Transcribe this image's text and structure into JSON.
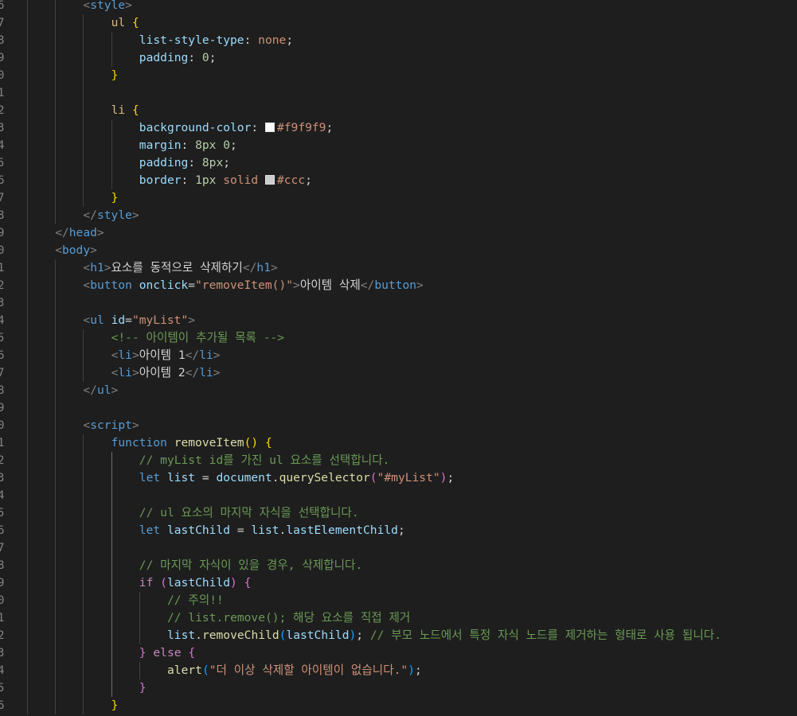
{
  "editor": {
    "language": "html",
    "theme": "dark",
    "lines": [
      {
        "n": "6",
        "indent": 2,
        "parts": [
          [
            "br",
            "<"
          ],
          [
            "tag",
            "style"
          ],
          [
            "br",
            ">"
          ]
        ]
      },
      {
        "n": "7",
        "indent": 3,
        "parts": [
          [
            "sel",
            "ul"
          ],
          [
            "txt",
            " "
          ],
          [
            "y",
            "{"
          ]
        ]
      },
      {
        "n": "8",
        "indent": 4,
        "parts": [
          [
            "prop",
            "list-style-type"
          ],
          [
            "txt",
            ": "
          ],
          [
            "val",
            "none"
          ],
          [
            "txt",
            ";"
          ]
        ]
      },
      {
        "n": "9",
        "indent": 4,
        "parts": [
          [
            "prop",
            "padding"
          ],
          [
            "txt",
            ": "
          ],
          [
            "num",
            "0"
          ],
          [
            "txt",
            ";"
          ]
        ]
      },
      {
        "n": "0",
        "indent": 3,
        "parts": [
          [
            "y",
            "}"
          ]
        ]
      },
      {
        "n": "1",
        "indent": 0,
        "parts": []
      },
      {
        "n": "2",
        "indent": 3,
        "parts": [
          [
            "sel",
            "li"
          ],
          [
            "txt",
            " "
          ],
          [
            "y",
            "{"
          ]
        ]
      },
      {
        "n": "3",
        "indent": 4,
        "parts": [
          [
            "prop",
            "background-color"
          ],
          [
            "txt",
            ": "
          ],
          [
            "swatch",
            "#f9f9f9"
          ],
          [
            "val",
            "#f9f9f9"
          ],
          [
            "txt",
            ";"
          ]
        ]
      },
      {
        "n": "4",
        "indent": 4,
        "parts": [
          [
            "prop",
            "margin"
          ],
          [
            "txt",
            ": "
          ],
          [
            "num",
            "8px 0"
          ],
          [
            "txt",
            ";"
          ]
        ]
      },
      {
        "n": "5",
        "indent": 4,
        "parts": [
          [
            "prop",
            "padding"
          ],
          [
            "txt",
            ": "
          ],
          [
            "num",
            "8px"
          ],
          [
            "txt",
            ";"
          ]
        ]
      },
      {
        "n": "6",
        "indent": 4,
        "parts": [
          [
            "prop",
            "border"
          ],
          [
            "txt",
            ": "
          ],
          [
            "num",
            "1px"
          ],
          [
            "txt",
            " "
          ],
          [
            "val",
            "solid"
          ],
          [
            "txt",
            " "
          ],
          [
            "swatch",
            "#cccccc"
          ],
          [
            "val",
            "#ccc"
          ],
          [
            "txt",
            ";"
          ]
        ]
      },
      {
        "n": "7",
        "indent": 3,
        "parts": [
          [
            "y",
            "}"
          ]
        ]
      },
      {
        "n": "8",
        "indent": 2,
        "parts": [
          [
            "br",
            "</"
          ],
          [
            "tag",
            "style"
          ],
          [
            "br",
            ">"
          ]
        ]
      },
      {
        "n": "9",
        "indent": 1,
        "parts": [
          [
            "br",
            "</"
          ],
          [
            "tag",
            "head"
          ],
          [
            "br",
            ">"
          ]
        ]
      },
      {
        "n": "0",
        "indent": 1,
        "parts": [
          [
            "br",
            "<"
          ],
          [
            "tag",
            "body"
          ],
          [
            "br",
            ">"
          ]
        ]
      },
      {
        "n": "1",
        "indent": 2,
        "parts": [
          [
            "br",
            "<"
          ],
          [
            "tag",
            "h1"
          ],
          [
            "br",
            ">"
          ],
          [
            "txt",
            "요소를 동적으로 삭제하기"
          ],
          [
            "br",
            "</"
          ],
          [
            "tag",
            "h1"
          ],
          [
            "br",
            ">"
          ]
        ]
      },
      {
        "n": "2",
        "indent": 2,
        "parts": [
          [
            "br",
            "<"
          ],
          [
            "tag",
            "button"
          ],
          [
            "txt",
            " "
          ],
          [
            "attr",
            "onclick"
          ],
          [
            "txt",
            "="
          ],
          [
            "str",
            "\"removeItem()\""
          ],
          [
            "br",
            ">"
          ],
          [
            "txt",
            "아이템 삭제"
          ],
          [
            "br",
            "</"
          ],
          [
            "tag",
            "button"
          ],
          [
            "br",
            ">"
          ]
        ]
      },
      {
        "n": "3",
        "indent": 0,
        "parts": []
      },
      {
        "n": "4",
        "indent": 2,
        "parts": [
          [
            "br",
            "<"
          ],
          [
            "tag",
            "ul"
          ],
          [
            "txt",
            " "
          ],
          [
            "attr",
            "id"
          ],
          [
            "txt",
            "="
          ],
          [
            "str",
            "\"myList\""
          ],
          [
            "br",
            ">"
          ]
        ]
      },
      {
        "n": "5",
        "indent": 3,
        "parts": [
          [
            "cmt",
            "<!-- 아이템이 추가될 목록 -->"
          ]
        ]
      },
      {
        "n": "6",
        "indent": 3,
        "parts": [
          [
            "br",
            "<"
          ],
          [
            "tag",
            "li"
          ],
          [
            "br",
            ">"
          ],
          [
            "txt",
            "아이템 1"
          ],
          [
            "br",
            "</"
          ],
          [
            "tag",
            "li"
          ],
          [
            "br",
            ">"
          ]
        ]
      },
      {
        "n": "7",
        "indent": 3,
        "parts": [
          [
            "br",
            "<"
          ],
          [
            "tag",
            "li"
          ],
          [
            "br",
            ">"
          ],
          [
            "txt",
            "아이템 2"
          ],
          [
            "br",
            "</"
          ],
          [
            "tag",
            "li"
          ],
          [
            "br",
            ">"
          ]
        ]
      },
      {
        "n": "8",
        "indent": 2,
        "parts": [
          [
            "br",
            "</"
          ],
          [
            "tag",
            "ul"
          ],
          [
            "br",
            ">"
          ]
        ]
      },
      {
        "n": "9",
        "indent": 0,
        "parts": []
      },
      {
        "n": "0",
        "indent": 2,
        "parts": [
          [
            "br",
            "<"
          ],
          [
            "tag",
            "script"
          ],
          [
            "br",
            ">"
          ]
        ]
      },
      {
        "n": "1",
        "indent": 3,
        "parts": [
          [
            "kw",
            "function"
          ],
          [
            "txt",
            " "
          ],
          [
            "fn",
            "removeItem"
          ],
          [
            "y",
            "()"
          ],
          [
            "txt",
            " "
          ],
          [
            "y",
            "{"
          ]
        ]
      },
      {
        "n": "2",
        "indent": 4,
        "parts": [
          [
            "cmt",
            "// myList id를 가진 ul 요소를 선택합니다."
          ]
        ]
      },
      {
        "n": "3",
        "indent": 4,
        "parts": [
          [
            "kw",
            "let"
          ],
          [
            "txt",
            " "
          ],
          [
            "var",
            "list"
          ],
          [
            "txt",
            " = "
          ],
          [
            "var",
            "document"
          ],
          [
            "txt",
            "."
          ],
          [
            "fn",
            "querySelector"
          ],
          [
            "p",
            "("
          ],
          [
            "str",
            "\"#myList\""
          ],
          [
            "p",
            ")"
          ],
          [
            "txt",
            ";"
          ]
        ]
      },
      {
        "n": "4",
        "indent": 0,
        "parts": []
      },
      {
        "n": "5",
        "indent": 4,
        "parts": [
          [
            "cmt",
            "// ul 요소의 마지막 자식을 선택합니다."
          ]
        ]
      },
      {
        "n": "6",
        "indent": 4,
        "parts": [
          [
            "kw",
            "let"
          ],
          [
            "txt",
            " "
          ],
          [
            "var",
            "lastChild"
          ],
          [
            "txt",
            " = "
          ],
          [
            "var",
            "list"
          ],
          [
            "txt",
            "."
          ],
          [
            "var",
            "lastElementChild"
          ],
          [
            "txt",
            ";"
          ]
        ]
      },
      {
        "n": "7",
        "indent": 0,
        "parts": []
      },
      {
        "n": "8",
        "indent": 4,
        "parts": [
          [
            "cmt",
            "// 마지막 자식이 있을 경우, 삭제합니다."
          ]
        ]
      },
      {
        "n": "9",
        "indent": 4,
        "parts": [
          [
            "ctrl",
            "if"
          ],
          [
            "txt",
            " "
          ],
          [
            "p",
            "("
          ],
          [
            "var",
            "lastChild"
          ],
          [
            "p",
            ")"
          ],
          [
            "txt",
            " "
          ],
          [
            "p",
            "{"
          ]
        ]
      },
      {
        "n": "0",
        "indent": 5,
        "parts": [
          [
            "cmt",
            "// 주의!!"
          ]
        ]
      },
      {
        "n": "1",
        "indent": 5,
        "parts": [
          [
            "cmt",
            "// list.remove(); 해당 요소를 직접 제거"
          ]
        ]
      },
      {
        "n": "2",
        "indent": 5,
        "parts": [
          [
            "var",
            "list"
          ],
          [
            "txt",
            "."
          ],
          [
            "fn",
            "removeChild"
          ],
          [
            "b",
            "("
          ],
          [
            "var",
            "lastChild"
          ],
          [
            "b",
            ")"
          ],
          [
            "txt",
            "; "
          ],
          [
            "cmt",
            "// 부모 노드에서 특정 자식 노드를 제거하는 형태로 사용 됩니다."
          ]
        ]
      },
      {
        "n": "3",
        "indent": 4,
        "parts": [
          [
            "p",
            "}"
          ],
          [
            "txt",
            " "
          ],
          [
            "ctrl",
            "else"
          ],
          [
            "txt",
            " "
          ],
          [
            "p",
            "{"
          ]
        ]
      },
      {
        "n": "4",
        "indent": 5,
        "parts": [
          [
            "fn",
            "alert"
          ],
          [
            "b",
            "("
          ],
          [
            "str",
            "\"더 이상 삭제할 아이템이 없습니다.\""
          ],
          [
            "b",
            ")"
          ],
          [
            "txt",
            ";"
          ]
        ]
      },
      {
        "n": "5",
        "indent": 4,
        "parts": [
          [
            "p",
            "}"
          ]
        ]
      },
      {
        "n": "6",
        "indent": 3,
        "parts": [
          [
            "y",
            "}"
          ]
        ]
      }
    ]
  }
}
